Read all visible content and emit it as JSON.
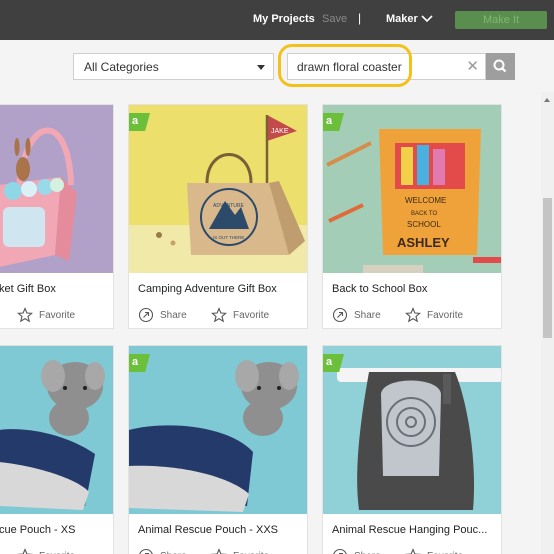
{
  "topbar": {
    "my_projects": "My Projects",
    "save": "Save",
    "separator": "|",
    "machine": "Maker",
    "make_it": "Make It"
  },
  "filters": {
    "category": "All Categories",
    "search_value": "drawn floral coaster"
  },
  "badge_letter": "a",
  "actions": {
    "share": "Share",
    "favorite": "Favorite"
  },
  "cards": [
    {
      "title": "ket Gift Box"
    },
    {
      "title": "Camping Adventure Gift Box"
    },
    {
      "title": "Back to School Box"
    },
    {
      "title": "cue Pouch - XS"
    },
    {
      "title": "Animal Rescue Pouch - XXS"
    },
    {
      "title": "Animal Rescue Hanging Pouc..."
    }
  ],
  "art": {
    "tent_flag": "JAKE",
    "tent_text": "ADVENTURE",
    "tent_text2": "IS OUT THERE",
    "school_welcome": "WELCOME",
    "school_back": "BACK TO",
    "school_school": "SCHOOL",
    "school_name": "ASHLEY"
  },
  "colors": {
    "topbar": "#404040",
    "accent_green": "#6cbf3a",
    "make_it_bg": "#5a8e4e",
    "highlight": "#f2c21b"
  }
}
